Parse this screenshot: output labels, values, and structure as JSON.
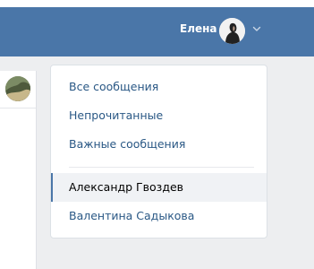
{
  "header": {
    "user_name": "Елена",
    "accent_color": "#4a76a8",
    "avatar_icon": "user-avatar",
    "dropdown_icon": "chevron-down-icon"
  },
  "menu": {
    "items": [
      {
        "label": "Все сообщения"
      },
      {
        "label": "Непрочитанные"
      },
      {
        "label": "Важные сообщения"
      },
      {
        "label": "Александр Гвоздев",
        "selected": true
      },
      {
        "label": "Валентина Садыкова"
      }
    ]
  }
}
